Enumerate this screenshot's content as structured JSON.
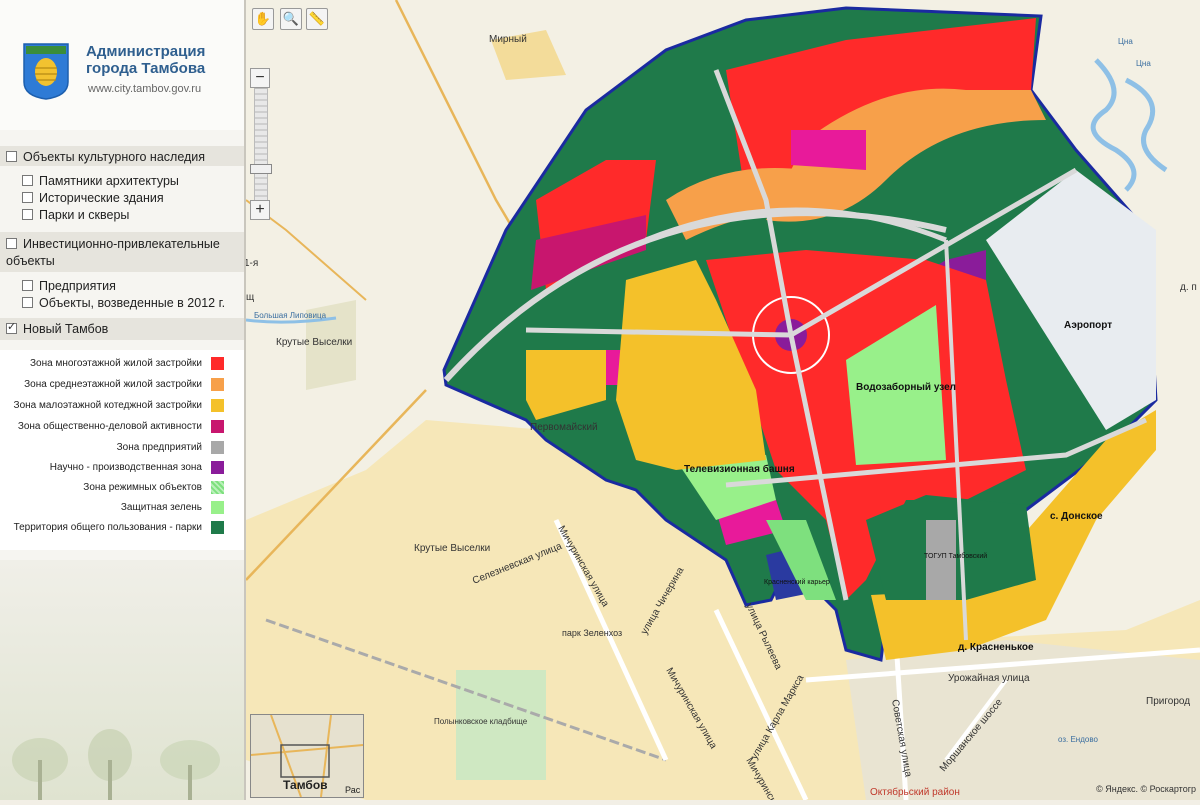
{
  "header": {
    "title": "Администрация города Тамбова",
    "url": "www.city.tambov.gov.ru"
  },
  "layers": [
    {
      "label": "Объекты культурного наследия",
      "checked": false,
      "group": true
    },
    {
      "label": "Памятники архитектуры",
      "checked": false,
      "group": false
    },
    {
      "label": "Исторические здания",
      "checked": false,
      "group": false
    },
    {
      "label": "Парки и скверы",
      "checked": false,
      "group": false
    },
    {
      "label": "Инвестиционно-привлекательные объекты",
      "checked": false,
      "group": true
    },
    {
      "label": "Предприятия",
      "checked": false,
      "group": false
    },
    {
      "label": "Объекты, возведенные в 2012 г.",
      "checked": false,
      "group": false
    },
    {
      "label": "Новый Тамбов",
      "checked": true,
      "group": true
    }
  ],
  "legend": [
    {
      "label": "Зона многоэтажной жилой застройки",
      "color": "#ff2a2a"
    },
    {
      "label": "Зона среднеэтажной жилой застройки",
      "color": "#f7a04a"
    },
    {
      "label": "Зона малоэтажной котеджной застройки",
      "color": "#f4c12a"
    },
    {
      "label": "Зона общественно-деловой активности",
      "color": "#c8166e"
    },
    {
      "label": "Зона предприятий",
      "color": "#a8a8a8"
    },
    {
      "label": "Научно - производственная зона",
      "color": "#8a1c9a"
    },
    {
      "label": "Зона режимных объектов",
      "color": "#7ee07e"
    },
    {
      "label": "Защитная зелень",
      "color": "#98f08a"
    },
    {
      "label": "Территория общего пользования - парки",
      "color": "#1f7a4a"
    }
  ],
  "map_labels": {
    "mirny": "Мирный",
    "krutye_vyselki_1": "Крутые Выселки",
    "krutye_vyselki_2": "Крутые Выселки",
    "pervomaisky": "Первомайский",
    "bolshaya_lipovitsa": "Большая Липовица",
    "airport": "Аэропорт",
    "water_intake": "Водозаборный узел",
    "tv_tower": "Телевизионная башня",
    "donskoe": "с. Донское",
    "krasnenkoe": "д. Красненькое",
    "krasnensky_karier": "Красненский карьер",
    "tgtu": "ТОГУП Тамбовский",
    "seleznevskaya": "Селезневская улица",
    "michurinskaya_1": "Мичуринская улица",
    "michurinskaya_2": "Мичуринская улица",
    "michurinskaya_3": "Мичуринская улица",
    "chicherina": "улица Чичерина",
    "ryleeva": "улица Рылеева",
    "karla_marksa": "улица Карла Маркса",
    "sovetskaya": "Советская улица",
    "urozhainaya": "Урожайная улица",
    "morshanskoe": "Моршанское шоссе",
    "park_zelenhoz": "парк Зеленхоз",
    "polynkovskoe": "Полынковское кладбище",
    "oktyabrsky": "Октябрьский район",
    "prigorodny": "Пригород",
    "endovo": "оз. Ендово",
    "tsna_1": "Цна",
    "tsna_2": "Цна",
    "frag_1ya": "1-я",
    "frag_shch": "щ",
    "frag_dp": "д. п"
  },
  "minimap": {
    "city": "Тамбов",
    "frag": "Рас"
  },
  "copyright": "© Яндекс. © Роскартогр",
  "tools": [
    "hand-tool",
    "zoom-box-tool",
    "ruler-tool"
  ]
}
